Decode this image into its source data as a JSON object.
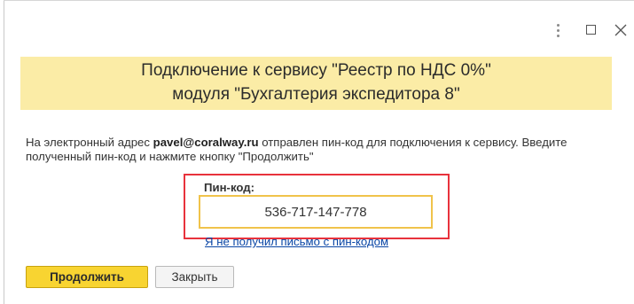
{
  "window": {
    "controls": {
      "more": "more-options",
      "maximize": "maximize",
      "close": "close"
    }
  },
  "header": {
    "line1": "Подключение к сервису \"Реестр по НДС 0%\"",
    "line2": "модуля \"Бухгалтерия экспедитора 8\""
  },
  "info": {
    "part1": "На электронный адрес ",
    "email": "pavel@coralway.ru",
    "part2": " отправлен пин-код для подключения к сервису. Введите полученный пин-код и нажмите кнопку \"Продолжить\""
  },
  "pin": {
    "label": "Пин-код:",
    "value": "536-717-147-778"
  },
  "links": {
    "no_letter": "Я не получил письмо с пин-кодом"
  },
  "buttons": {
    "continue": "Продолжить",
    "close": "Закрыть"
  },
  "colors": {
    "banner": "#fbeca6",
    "primary_button": "#f8d431",
    "highlight_frame": "#e8323c",
    "input_focus": "#f0c34b",
    "link": "#0b46a5"
  }
}
